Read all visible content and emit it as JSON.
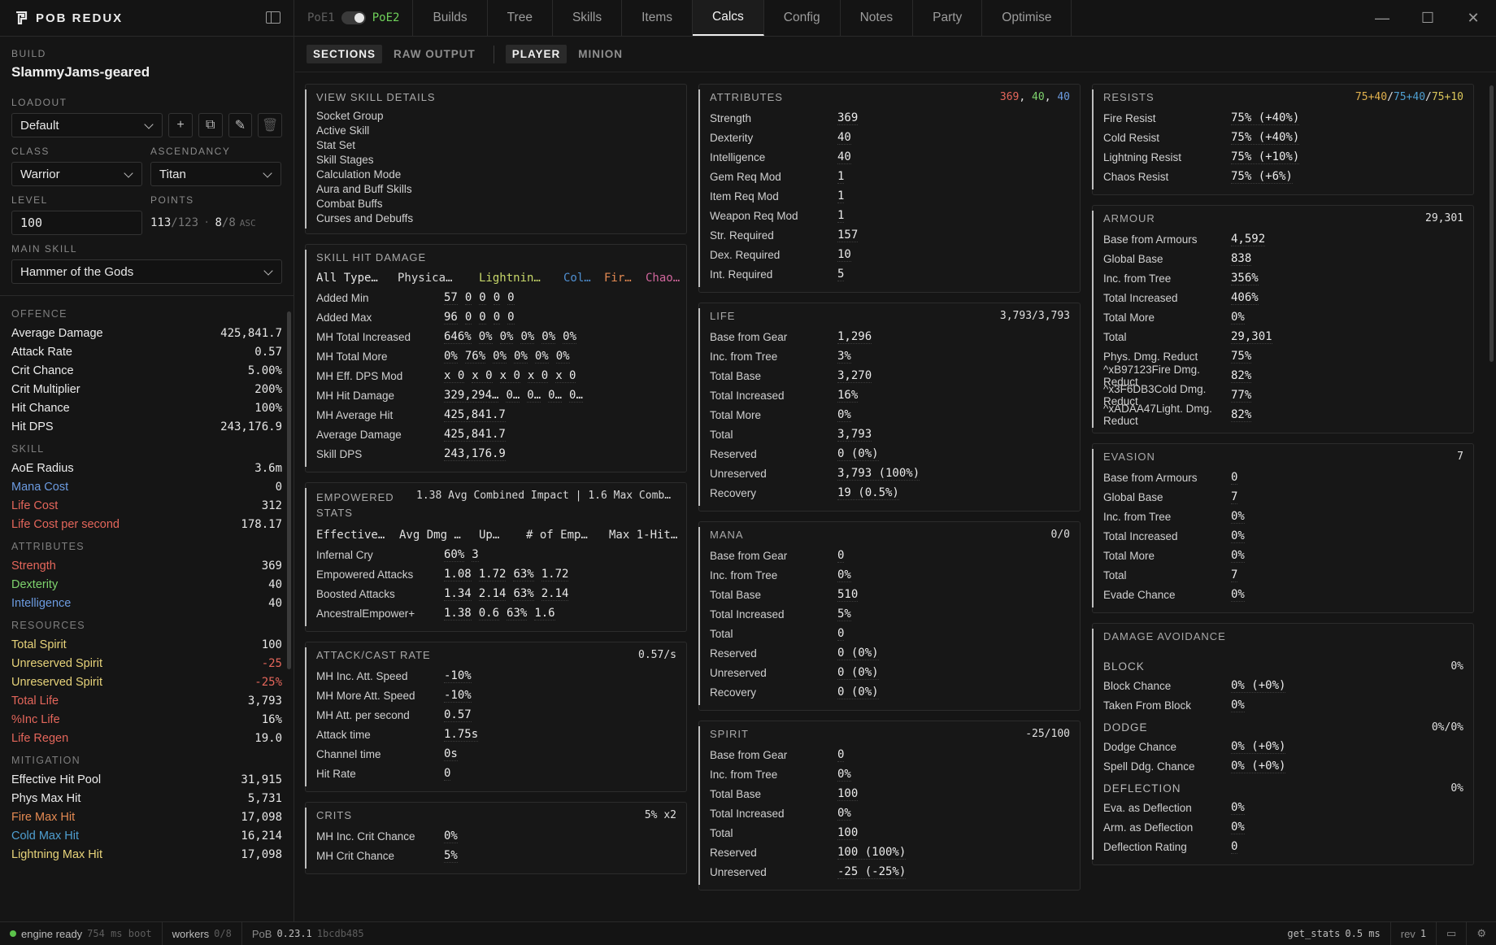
{
  "app": {
    "brand": "POB REDUX",
    "poe1": "PoE1",
    "poe2": "PoE2"
  },
  "tabs": [
    "Builds",
    "Tree",
    "Skills",
    "Items",
    "Calcs",
    "Config",
    "Notes",
    "Party",
    "Optimise"
  ],
  "sidebar": {
    "build_label": "BUILD",
    "build_name": "SlammyJams-geared",
    "loadout_label": "LOADOUT",
    "loadout": "Default",
    "class_label": "CLASS",
    "class": "Warrior",
    "ascendancy_label": "ASCENDANCY",
    "ascendancy": "Titan",
    "level_label": "LEVEL",
    "level": "100",
    "points_label": "POINTS",
    "points_used": "113",
    "points_total": "/123",
    "points_sep": "·",
    "asc_used": "8",
    "asc_total": "/8",
    "asc_label": "ASC",
    "main_skill_label": "MAIN SKILL",
    "main_skill": "Hammer of the Gods",
    "sections": [
      {
        "title": "OFFENCE",
        "rows": [
          [
            "Average Damage",
            "425,841.7",
            "white"
          ],
          [
            "Attack Rate",
            "0.57",
            "white"
          ],
          [
            "Crit Chance",
            "5.00%",
            "white"
          ],
          [
            "Crit Multiplier",
            "200%",
            "white"
          ],
          [
            "Hit Chance",
            "100%",
            "white"
          ],
          [
            "Hit DPS",
            "243,176.9",
            "white"
          ]
        ]
      },
      {
        "title": "SKILL",
        "rows": [
          [
            "AoE Radius",
            "3.6m",
            "white"
          ],
          [
            "Mana Cost",
            "0",
            "blue"
          ],
          [
            "Life Cost",
            "312",
            "red"
          ],
          [
            "Life Cost per second",
            "178.17",
            "red"
          ]
        ]
      },
      {
        "title": "ATTRIBUTES",
        "rows": [
          [
            "Strength",
            "369",
            "red"
          ],
          [
            "Dexterity",
            "40",
            "green"
          ],
          [
            "Intelligence",
            "40",
            "blue"
          ]
        ]
      },
      {
        "title": "RESOURCES",
        "rows": [
          [
            "Total Spirit",
            "100",
            "yellow"
          ],
          [
            "Unreserved Spirit",
            "-25",
            "yellow"
          ],
          [
            "Unreserved Spirit",
            "-25%",
            "yellow"
          ],
          [
            "Total Life",
            "3,793",
            "red"
          ],
          [
            "%Inc Life",
            "16%",
            "red"
          ],
          [
            "Life Regen",
            "19.0",
            "red"
          ]
        ]
      },
      {
        "title": "MITIGATION",
        "rows": [
          [
            "Effective Hit Pool",
            "31,915",
            "white"
          ],
          [
            "Phys Max Hit",
            "5,731",
            "white"
          ],
          [
            "Fire Max Hit",
            "17,098",
            "orange"
          ],
          [
            "Cold Max Hit",
            "16,214",
            "cyan"
          ],
          [
            "Lightning Max Hit",
            "17,098",
            "yellow"
          ]
        ]
      }
    ]
  },
  "subtabs": {
    "sections": "SECTIONS",
    "raw": "RAW OUTPUT",
    "player": "PLAYER",
    "minion": "MINION"
  },
  "col1": {
    "view": {
      "title": "VIEW SKILL DETAILS",
      "items": [
        "Socket Group",
        "Active Skill",
        "Stat Set",
        "Skill Stages",
        "Calculation Mode",
        "Aura and Buff Skills",
        "Combat Buffs",
        "Curses and Debuffs"
      ]
    },
    "hit": {
      "title": "SKILL HIT DAMAGE",
      "headers": [
        "All Type…",
        "Physica…",
        "Lightnin…",
        "Col…",
        "Fir…",
        "Chao…"
      ],
      "rows": [
        [
          "Added Min",
          [
            "57",
            "0",
            "0",
            "0",
            "0"
          ]
        ],
        [
          "Added Max",
          [
            "96",
            "0",
            "0",
            "0",
            "0"
          ]
        ],
        [
          "MH Total Increased",
          [
            "646%",
            "0%",
            "0%",
            "0%",
            "0%",
            "0%"
          ]
        ],
        [
          "MH Total More",
          [
            "0%",
            "76%",
            "0%",
            "0%",
            "0%",
            "0%"
          ]
        ],
        [
          "MH Eff. DPS Mod",
          [
            "x 0",
            "x 0",
            "x 0",
            "x 0",
            "x 0"
          ]
        ],
        [
          "MH Hit Damage",
          [
            "329,294…",
            "0…",
            "0…",
            "0…",
            "0…"
          ]
        ],
        [
          "MH Average Hit",
          [
            "425,841.7"
          ]
        ],
        [
          "Average Damage",
          [
            "425,841.7"
          ]
        ],
        [
          "Skill DPS",
          [
            "243,176.9"
          ]
        ]
      ]
    },
    "emp": {
      "title": "EMPOWERED",
      "title2": "STATS",
      "summary": "1.38 Avg Combined Impact | 1.6 Max Comb…",
      "headers": [
        "Effective…",
        "Avg Dmg …",
        "Up…",
        "# of Emp…",
        "Max 1-Hit…"
      ],
      "rows": [
        [
          "Infernal Cry",
          [
            "60%",
            "3"
          ]
        ],
        [
          "Empowered Attacks",
          [
            "1.08",
            "1.72",
            "63%",
            "1.72"
          ]
        ],
        [
          "Boosted Attacks",
          [
            "1.34",
            "2.14",
            "63%",
            "2.14"
          ]
        ],
        [
          "AncestralEmpower+",
          [
            "1.38",
            "0.6",
            "63%",
            "1.6"
          ]
        ]
      ]
    },
    "rate": {
      "title": "ATTACK/CAST RATE",
      "right": "0.57/s",
      "rows": [
        [
          "MH Inc. Att. Speed",
          "-10%"
        ],
        [
          "MH More Att. Speed",
          "-10%"
        ],
        [
          "MH Att. per second",
          "0.57"
        ],
        [
          "Attack time",
          "1.75s"
        ],
        [
          "Channel time",
          "0s"
        ],
        [
          "Hit Rate",
          "0"
        ]
      ]
    },
    "crits": {
      "title": "CRITS",
      "right": "5% x2",
      "rows": [
        [
          "MH Inc. Crit Chance",
          "0%"
        ],
        [
          "MH Crit Chance",
          "5%"
        ]
      ]
    }
  },
  "col2": {
    "attr": {
      "title": "ATTRIBUTES",
      "str": "369",
      "dex": "40",
      "int": "40",
      "rows": [
        [
          "Strength",
          "369"
        ],
        [
          "Dexterity",
          "40"
        ],
        [
          "Intelligence",
          "40"
        ],
        [
          "Gem Req Mod",
          "1"
        ],
        [
          "Item Req Mod",
          "1"
        ],
        [
          "Weapon Req Mod",
          "1"
        ],
        [
          "Str. Required",
          "157"
        ],
        [
          "Dex. Required",
          "10"
        ],
        [
          "Int. Required",
          "5"
        ]
      ]
    },
    "life": {
      "title": "LIFE",
      "right": "3,793/3,793",
      "rows": [
        [
          "Base from Gear",
          "1,296"
        ],
        [
          "Inc. from Tree",
          "3%"
        ],
        [
          "Total Base",
          "3,270"
        ],
        [
          "Total Increased",
          "16%"
        ],
        [
          "Total More",
          "0%"
        ],
        [
          "Total",
          "3,793"
        ],
        [
          "Reserved",
          "0 (0%)"
        ],
        [
          "Unreserved",
          "3,793 (100%)"
        ],
        [
          "Recovery",
          "19 (0.5%)"
        ]
      ]
    },
    "mana": {
      "title": "MANA",
      "right": "0/0",
      "rows": [
        [
          "Base from Gear",
          "0"
        ],
        [
          "Inc. from Tree",
          "0%"
        ],
        [
          "Total Base",
          "510"
        ],
        [
          "Total Increased",
          "5%"
        ],
        [
          "Total",
          "0"
        ],
        [
          "Reserved",
          "0 (0%)"
        ],
        [
          "Unreserved",
          "0 (0%)"
        ],
        [
          "Recovery",
          "0 (0%)"
        ]
      ]
    },
    "spirit": {
      "title": "SPIRIT",
      "right": "-25/100",
      "rows": [
        [
          "Base from Gear",
          "0"
        ],
        [
          "Inc. from Tree",
          "0%"
        ],
        [
          "Total Base",
          "100"
        ],
        [
          "Total Increased",
          "0%"
        ],
        [
          "Total",
          "100"
        ],
        [
          "Reserved",
          "100 (100%)"
        ],
        [
          "Unreserved",
          "-25 (-25%)"
        ]
      ]
    }
  },
  "col3": {
    "res": {
      "title": "RESISTS",
      "r1": "75+40",
      "r2": "75+40",
      "r3": "75+10",
      "rows": [
        [
          "Fire Resist",
          "75% (+40%)"
        ],
        [
          "Cold Resist",
          "75% (+40%)"
        ],
        [
          "Lightning Resist",
          "75% (+10%)"
        ],
        [
          "Chaos Resist",
          "75% (+6%)"
        ]
      ]
    },
    "armour": {
      "title": "ARMOUR",
      "right": "29,301",
      "rows": [
        [
          "Base from Armours",
          "4,592"
        ],
        [
          "Global Base",
          "838"
        ],
        [
          "Inc. from Tree",
          "356%"
        ],
        [
          "Total Increased",
          "406%"
        ],
        [
          "Total More",
          "0%"
        ],
        [
          "Total",
          "29,301"
        ],
        [
          "Phys. Dmg. Reduct",
          "75%"
        ],
        [
          "^xB97123Fire Dmg. Reduct",
          "82%"
        ],
        [
          "^x3F6DB3Cold Dmg. Reduct",
          "77%"
        ],
        [
          "^xADAA47Light. Dmg. Reduct",
          "82%"
        ]
      ]
    },
    "evasion": {
      "title": "EVASION",
      "right": "7",
      "rows": [
        [
          "Base from Armours",
          "0"
        ],
        [
          "Global Base",
          "7"
        ],
        [
          "Inc. from Tree",
          "0%"
        ],
        [
          "Total Increased",
          "0%"
        ],
        [
          "Total More",
          "0%"
        ],
        [
          "Total",
          "7"
        ],
        [
          "Evade Chance",
          "0%"
        ]
      ]
    },
    "avoid": {
      "title": "DAMAGE AVOIDANCE",
      "block": {
        "title": "BLOCK",
        "right": "0%",
        "rows": [
          [
            "Block Chance",
            "0% (+0%)"
          ],
          [
            "Taken From Block",
            "0%"
          ]
        ]
      },
      "dodge": {
        "title": "DODGE",
        "right": "0%/0%",
        "rows": [
          [
            "Dodge Chance",
            "0% (+0%)"
          ],
          [
            "Spell Ddg. Chance",
            "0% (+0%)"
          ]
        ]
      },
      "defl": {
        "title": "DEFLECTION",
        "right": "0%",
        "rows": [
          [
            "Eva. as Deflection",
            "0%"
          ],
          [
            "Arm. as Deflection",
            "0%"
          ],
          [
            "Deflection Rating",
            "0"
          ]
        ]
      }
    }
  },
  "status": {
    "engine": "engine ready",
    "boot": "754 ms boot",
    "workers_label": "workers",
    "workers": "0/8",
    "pob": "PoB",
    "ver": "0.23.1",
    "hash": "1bcdb485",
    "call": "get_stats",
    "ms": "0.5 ms",
    "rev_label": "rev",
    "rev": "1"
  },
  "colors": {
    "accent_green": "#6fd15a",
    "str_red": "#e4665b",
    "dex_green": "#7ed36d",
    "int_blue": "#6c9be0"
  }
}
